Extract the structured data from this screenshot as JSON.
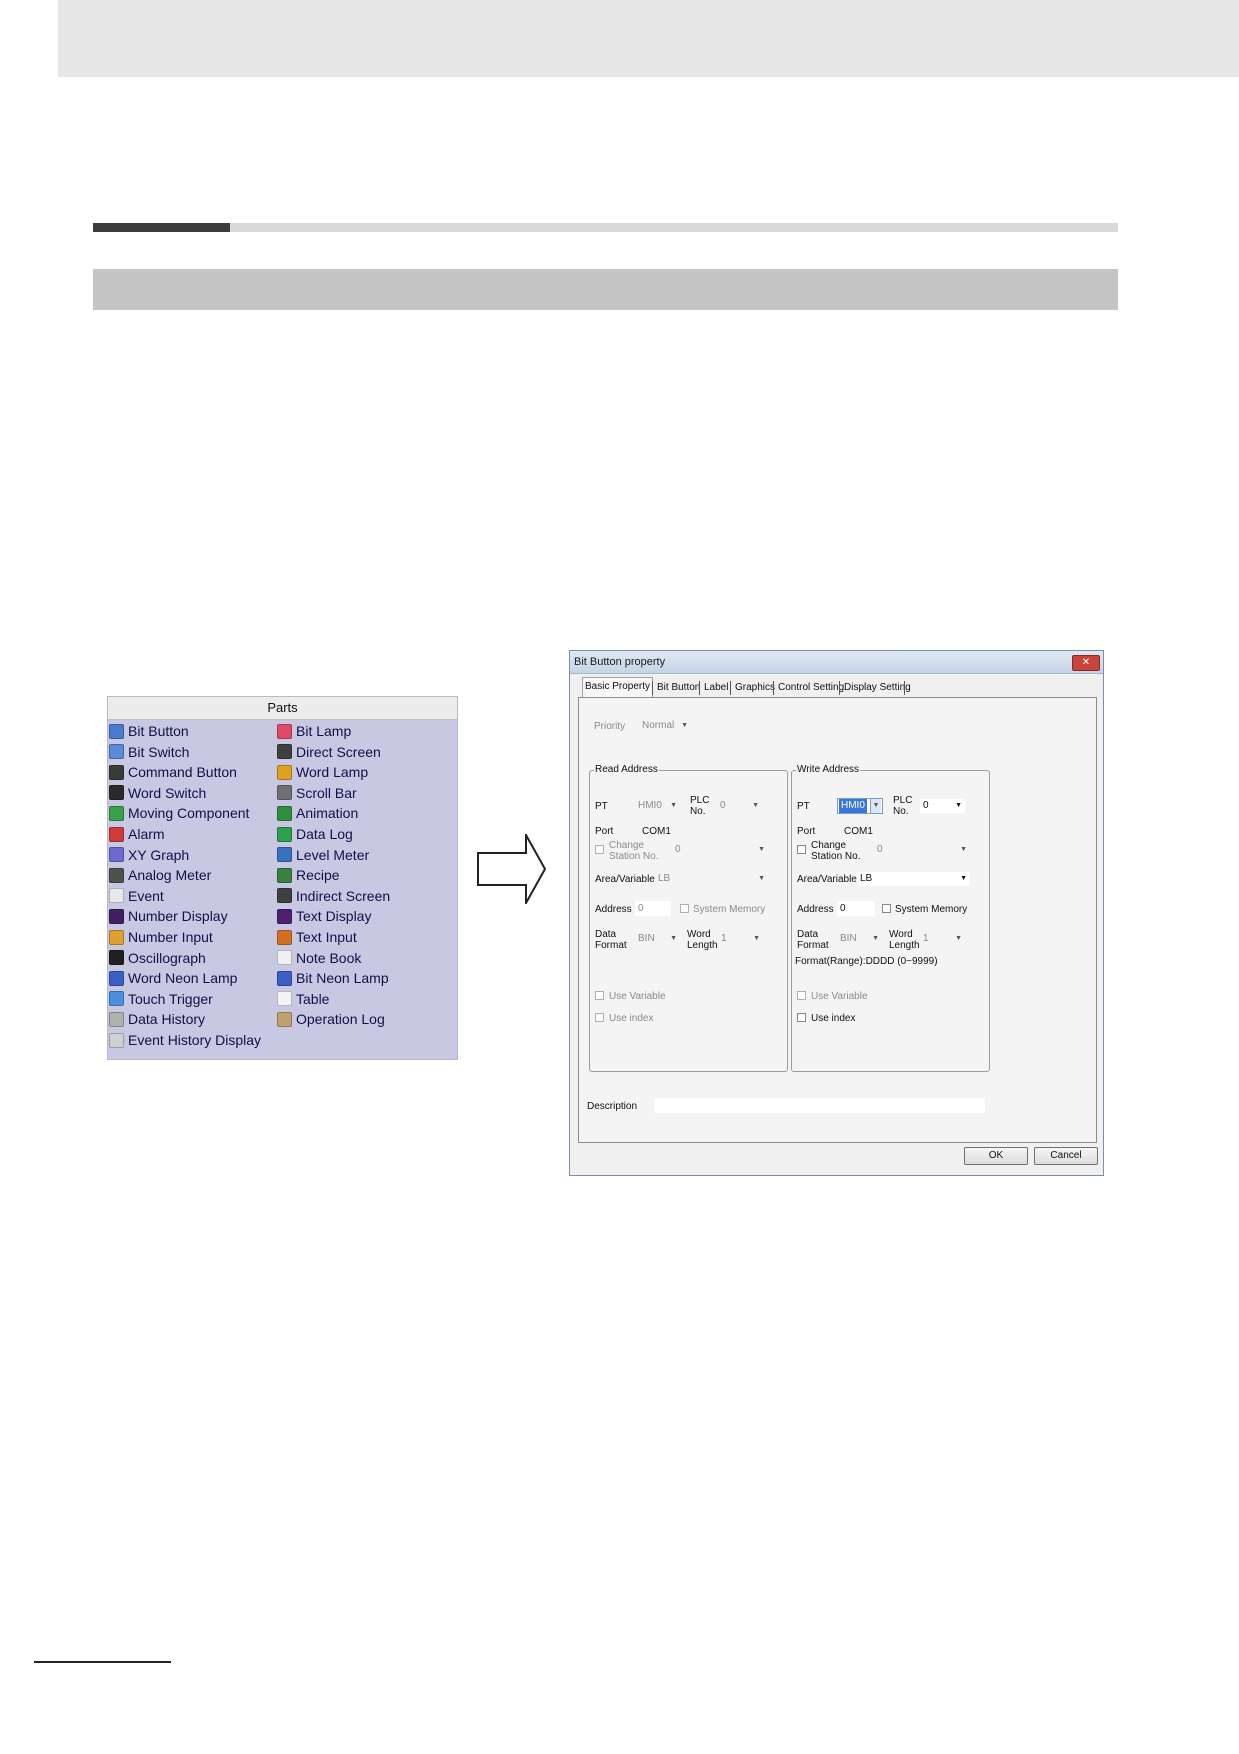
{
  "parts_panel": {
    "title": "Parts",
    "items": [
      {
        "label": "Bit Button",
        "icon": "bit-button-icon",
        "color": "#4a7bd0"
      },
      {
        "label": "Bit Lamp",
        "icon": "bit-lamp-icon",
        "color": "#e04a6a"
      },
      {
        "label": "Bit Switch",
        "icon": "bit-switch-icon",
        "color": "#5a8ad8"
      },
      {
        "label": "Direct Screen",
        "icon": "direct-screen-icon",
        "color": "#404040"
      },
      {
        "label": "Command Button",
        "icon": "command-button-icon",
        "color": "#3a3a3a"
      },
      {
        "label": "Word Lamp",
        "icon": "word-lamp-icon",
        "color": "#e0a020"
      },
      {
        "label": "Word Switch",
        "icon": "word-switch-icon",
        "color": "#2a2a2a"
      },
      {
        "label": "Scroll Bar",
        "icon": "scroll-bar-icon",
        "color": "#707070"
      },
      {
        "label": "Moving Component",
        "icon": "moving-component-icon",
        "color": "#3aa04a"
      },
      {
        "label": "Animation",
        "icon": "animation-icon",
        "color": "#2f8f3f"
      },
      {
        "label": "Alarm",
        "icon": "alarm-icon",
        "color": "#d03a3a"
      },
      {
        "label": "Data Log",
        "icon": "data-log-icon",
        "color": "#2aa050"
      },
      {
        "label": "XY Graph",
        "icon": "xy-graph-icon",
        "color": "#6a6ad0"
      },
      {
        "label": "Level Meter",
        "icon": "level-meter-icon",
        "color": "#3a70c0"
      },
      {
        "label": "Analog Meter",
        "icon": "analog-meter-icon",
        "color": "#505050"
      },
      {
        "label": "Recipe",
        "icon": "recipe-icon",
        "color": "#3a8040"
      },
      {
        "label": "Event",
        "icon": "event-icon",
        "color": "#e8e8e8"
      },
      {
        "label": "Indirect Screen",
        "icon": "indirect-screen-icon",
        "color": "#404040"
      },
      {
        "label": "Number Display",
        "icon": "number-display-icon",
        "color": "#402060"
      },
      {
        "label": "Text Display",
        "icon": "text-display-icon",
        "color": "#502070"
      },
      {
        "label": "Number Input",
        "icon": "number-input-icon",
        "color": "#e0a030"
      },
      {
        "label": "Text Input",
        "icon": "text-input-icon",
        "color": "#d07020"
      },
      {
        "label": "Oscillograph",
        "icon": "oscillograph-icon",
        "color": "#202020"
      },
      {
        "label": "Note Book",
        "icon": "note-book-icon",
        "color": "#f0f0f0"
      },
      {
        "label": "Word Neon Lamp",
        "icon": "word-neon-lamp-icon",
        "color": "#3a60c8"
      },
      {
        "label": "Bit Neon Lamp",
        "icon": "bit-neon-lamp-icon",
        "color": "#3a60c8"
      },
      {
        "label": "Touch Trigger",
        "icon": "touch-trigger-icon",
        "color": "#4a90e0"
      },
      {
        "label": "Table",
        "icon": "table-icon",
        "color": "#f4f4f4"
      },
      {
        "label": "Data History",
        "icon": "data-history-icon",
        "color": "#b0b0b0"
      },
      {
        "label": "Operation Log",
        "icon": "operation-log-icon",
        "color": "#c0a070"
      },
      {
        "label": "Event History Display",
        "icon": "event-history-display-icon",
        "color": "#d0d0d0"
      }
    ]
  },
  "dialog": {
    "title": "Bit Button property",
    "close_glyph": "✕",
    "tabs": [
      "Basic Property",
      "Bit Button",
      "Label",
      "Graphics",
      "Control Setting",
      "Display Setting"
    ],
    "priority": {
      "label": "Priority",
      "value": "Normal"
    },
    "read": {
      "title": "Read Address",
      "pt_label": "PT",
      "pt_value": "HMI0",
      "plc_label": "PLC\nNo.",
      "plc_value": "0",
      "port_label": "Port",
      "port_value": "COM1",
      "change_station_label": "Change\nStation No.",
      "station_value": "0",
      "area_label": "Area/Variable",
      "area_value": "LB",
      "address_label": "Address",
      "address_value": "0",
      "system_memory_label": "System Memory",
      "data_format_label": "Data\nFormat",
      "data_format_value": "BIN",
      "word_length_label": "Word\nLength",
      "word_length_value": "1",
      "use_variable_label": "Use Variable",
      "use_index_label": "Use index"
    },
    "write": {
      "title": "Write Address",
      "pt_label": "PT",
      "pt_value": "HMI0",
      "plc_label": "PLC\nNo.",
      "plc_value": "0",
      "port_label": "Port",
      "port_value": "COM1",
      "change_station_label": "Change\nStation No.",
      "station_value": "0",
      "area_label": "Area/Variable",
      "area_value": "LB",
      "address_label": "Address",
      "address_value": "0",
      "system_memory_label": "System Memory",
      "data_format_label": "Data\nFormat",
      "data_format_value": "BIN",
      "word_length_label": "Word\nLength",
      "word_length_value": "1",
      "format_range": "Format(Range):DDDD (0~9999)",
      "use_variable_label": "Use Variable",
      "use_index_label": "Use index"
    },
    "description_label": "Description",
    "description_value": "",
    "ok_label": "OK",
    "cancel_label": "Cancel",
    "dropdown_glyph": "▼"
  },
  "colors": {
    "parts_bg": "#c8c8e3",
    "selection": "#3a78d8"
  }
}
